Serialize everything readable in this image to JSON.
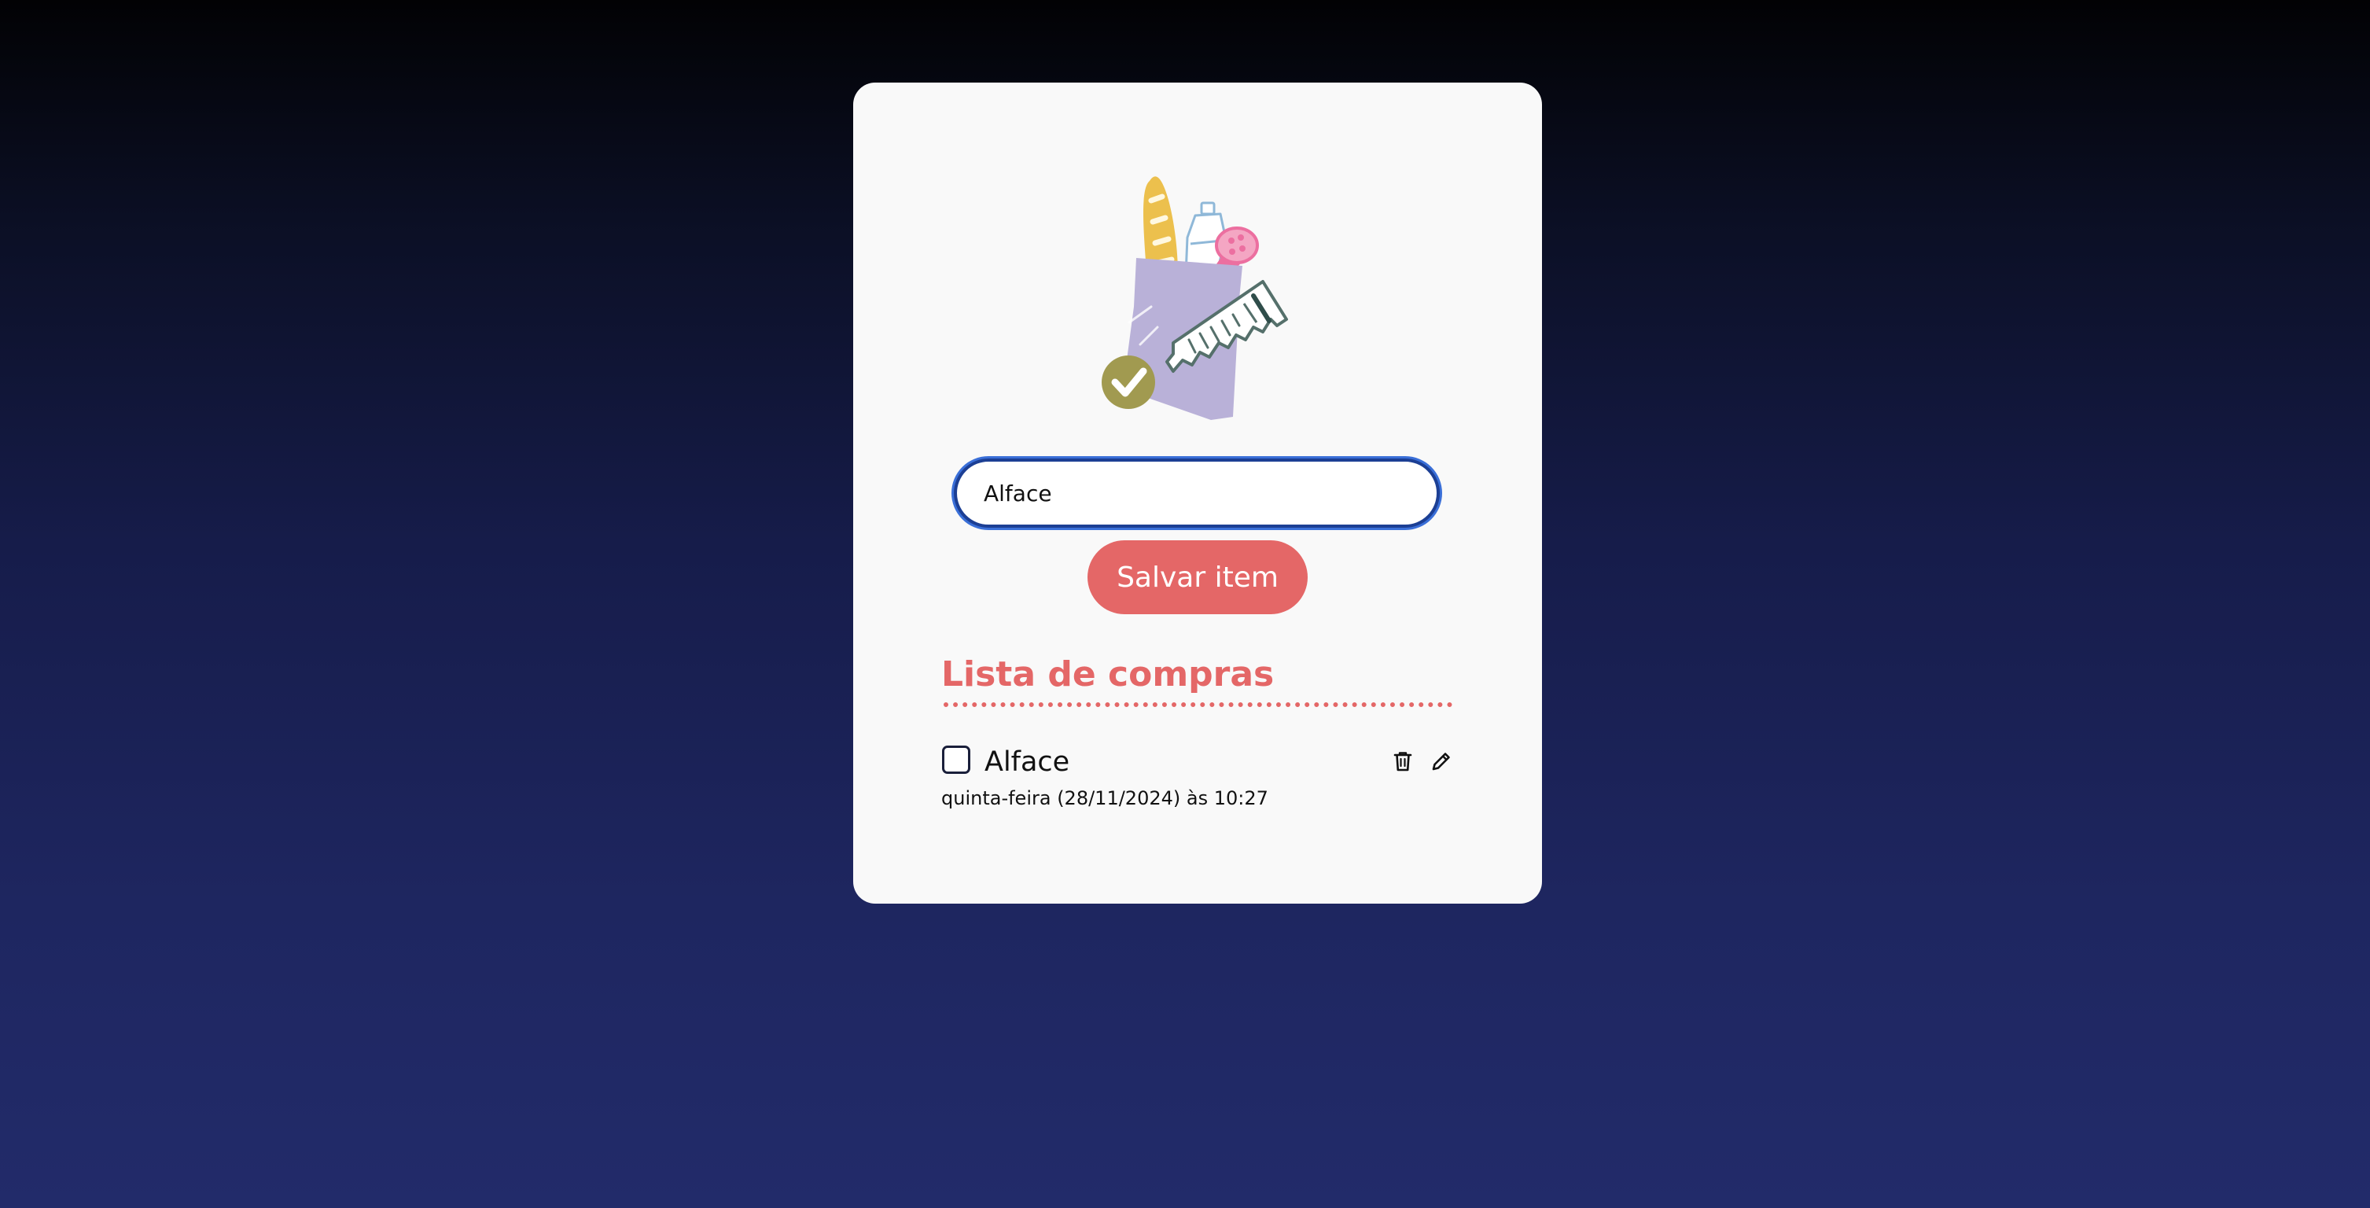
{
  "input": {
    "value": "Alface",
    "icon": "shopping-bag-illustration"
  },
  "actions": {
    "save_label": "Salvar item"
  },
  "list": {
    "title": "Lista de compras",
    "items": [
      {
        "name": "Alface",
        "date": "quinta-feira (28/11/2024) às 10:27",
        "checked": false,
        "delete_icon": "trash-icon",
        "edit_icon": "pencil-icon"
      }
    ]
  },
  "colors": {
    "accent": "#e46767",
    "card_background": "#f9f9f9",
    "input_border": "#1c3f94",
    "page_gradient_top": "#020204",
    "page_gradient_bottom": "#222b6a"
  }
}
